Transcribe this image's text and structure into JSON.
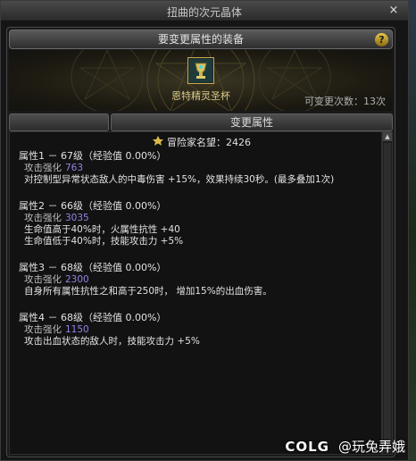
{
  "window": {
    "title": "扭曲的次元晶体",
    "close_label": "×"
  },
  "header": {
    "title": "要变更属性的装备",
    "help_label": "?"
  },
  "item": {
    "name": "恩特精灵圣杯",
    "remaining": "可变更次数：13次",
    "icon": "chalice-item-icon"
  },
  "section": {
    "title": "变更属性"
  },
  "fame": {
    "label": "冒险家名望：2426",
    "icon": "fame-crest-icon"
  },
  "attributes": [
    {
      "header": "属性1 － 67级（经验值 0.00%）",
      "stat_label": "攻击强化",
      "stat_value": "763",
      "desc": [
        "对控制型异常状态敌人的中毒伤害 +15%，效果持续30秒。(最多叠加1次)"
      ]
    },
    {
      "header": "属性2 － 66级（经验值 0.00%）",
      "stat_label": "攻击强化",
      "stat_value": "3035",
      "desc": [
        "生命值高于40%时，火属性抗性 +40",
        "生命值低于40%时，技能攻击力 +5%"
      ]
    },
    {
      "header": "属性3 － 68级（经验值 0.00%）",
      "stat_label": "攻击强化",
      "stat_value": "2300",
      "desc": [
        "自身所有属性抗性之和高于250时， 增加15%的出血伤害。"
      ]
    },
    {
      "header": "属性4 － 68级（经验值 0.00%）",
      "stat_label": "攻击强化",
      "stat_value": "1150",
      "desc": [
        "攻击出血状态的敌人时，技能攻击力 +5%"
      ]
    }
  ],
  "watermark": {
    "logo": "COLG",
    "user": "@玩兔弄娥"
  },
  "colors": {
    "stat_value": "#8f86e6",
    "item_name": "#d9c98a",
    "accent_gold": "#c9a84a"
  }
}
